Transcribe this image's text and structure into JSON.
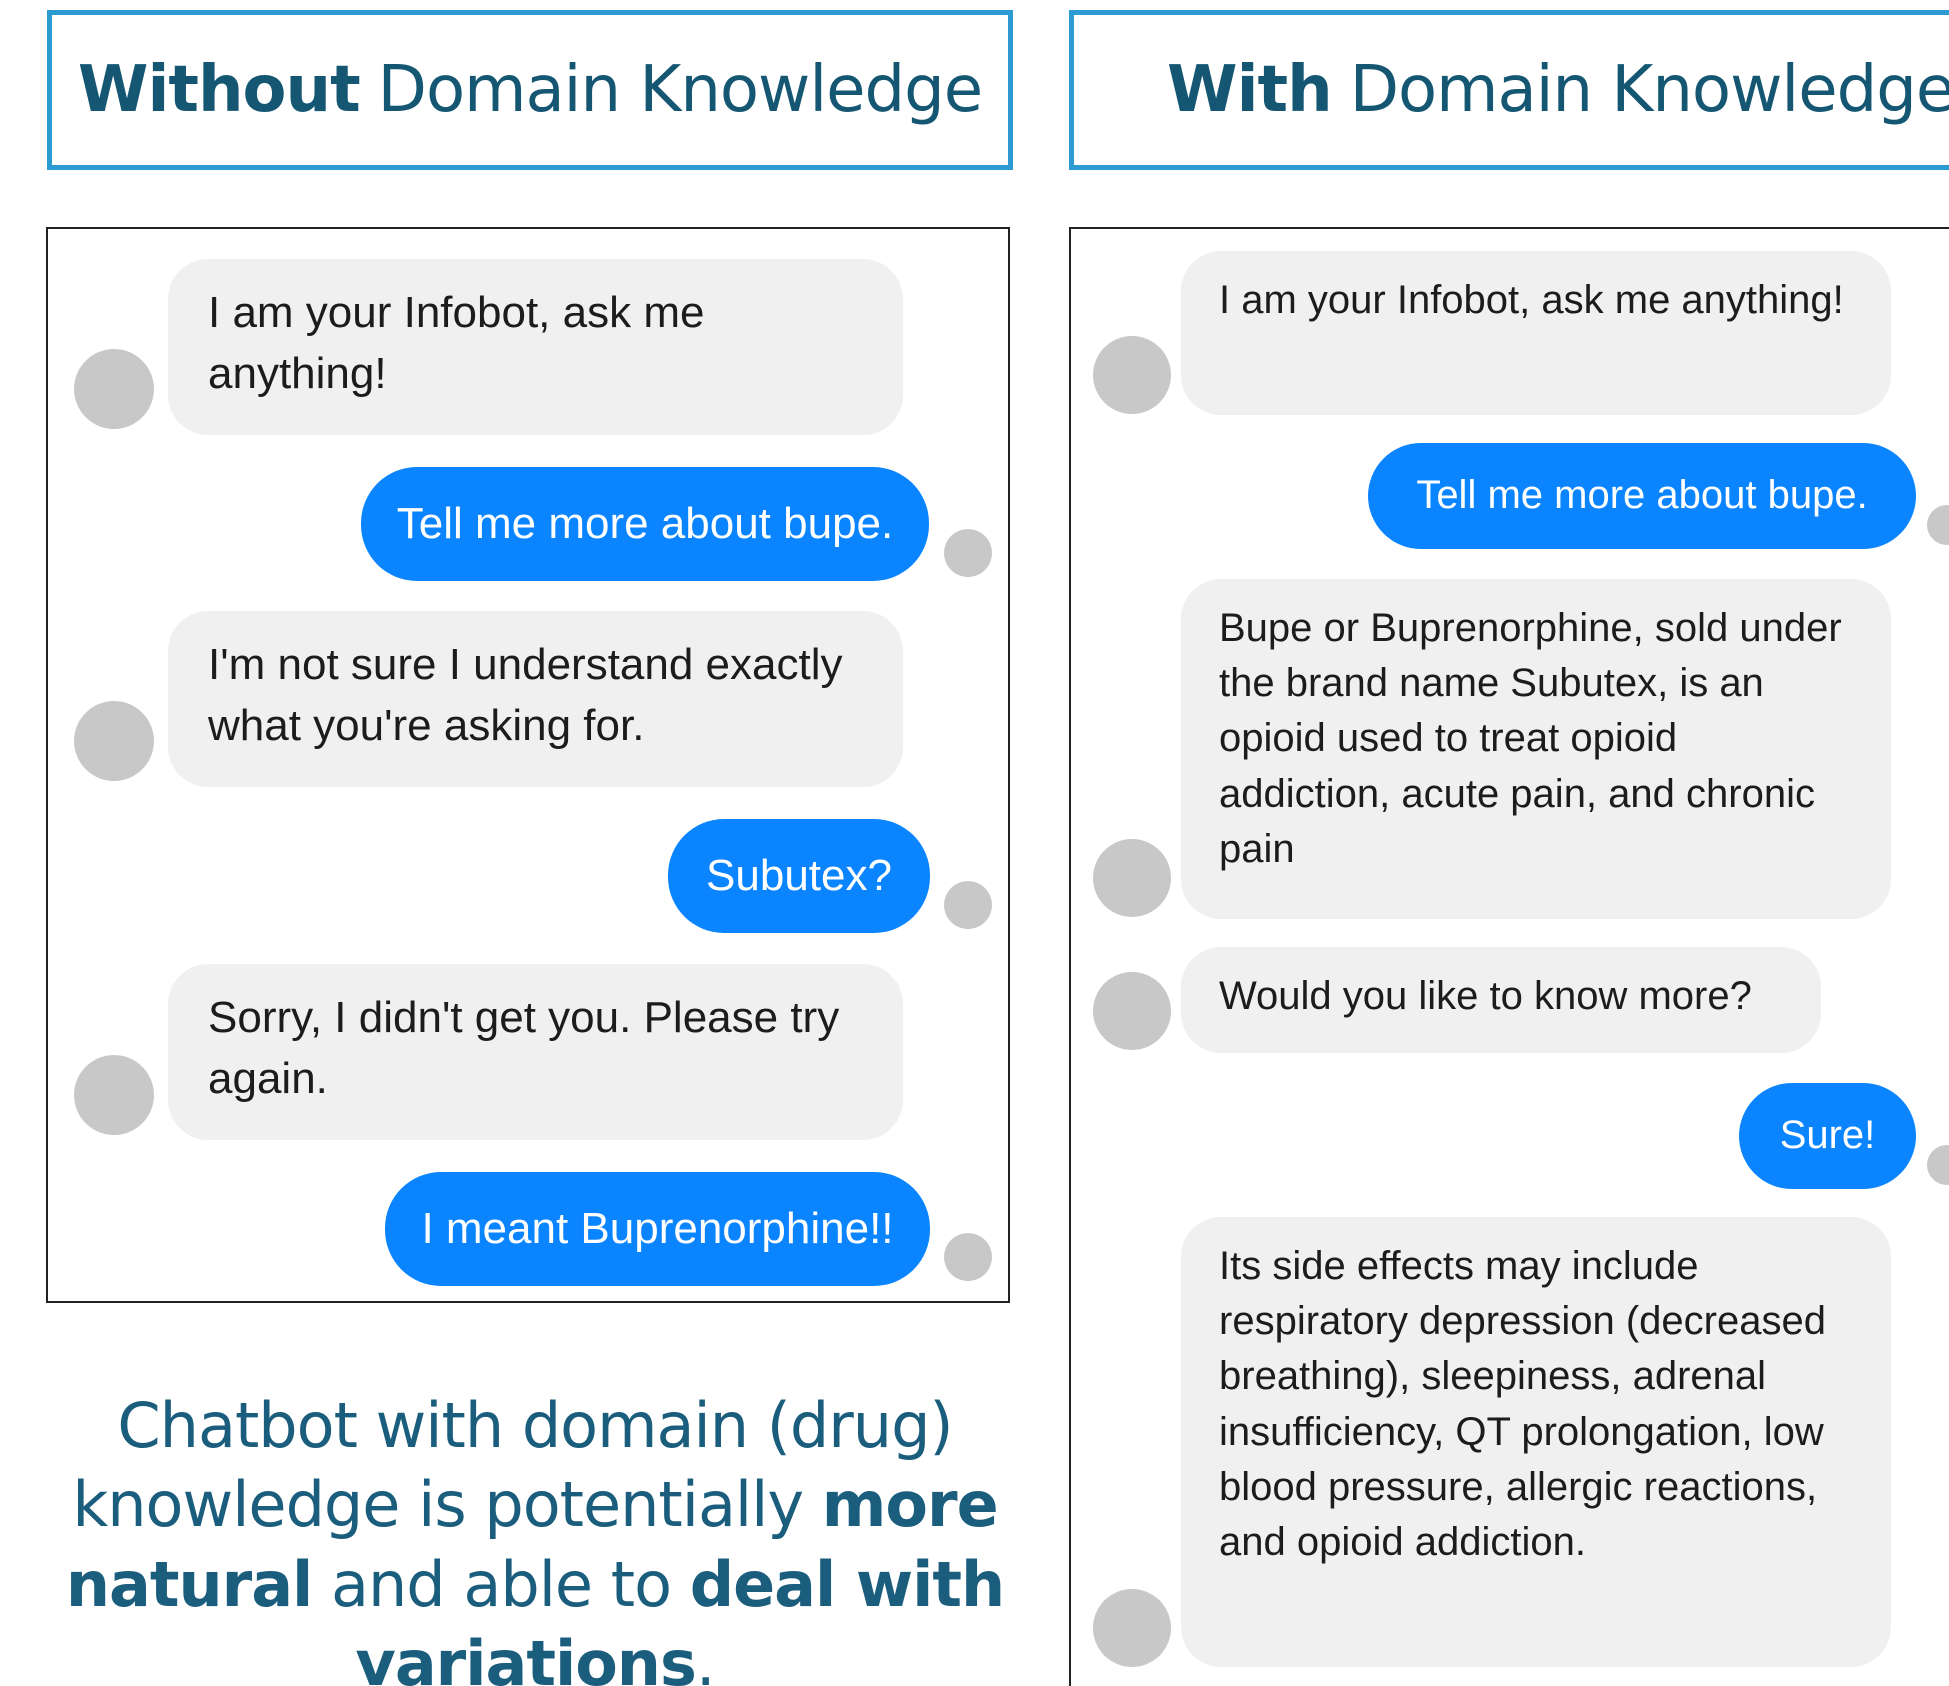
{
  "headers": {
    "left": {
      "strong": "Without",
      "normal": "Domain Knowledge"
    },
    "right": {
      "strong": "With",
      "normal": "Domain Knowledge"
    }
  },
  "left_chat": {
    "messages": [
      {
        "role": "bot",
        "text": "I am your Infobot, ask me anything!"
      },
      {
        "role": "user",
        "text": "Tell me more about bupe."
      },
      {
        "role": "bot",
        "text": "I'm not sure I understand exactly what you're asking for."
      },
      {
        "role": "user",
        "text": "Subutex?"
      },
      {
        "role": "bot",
        "text": "Sorry, I didn't get you. Please try again."
      },
      {
        "role": "user",
        "text": "I meant Buprenorphine!!"
      }
    ]
  },
  "right_chat": {
    "messages": [
      {
        "role": "bot",
        "text": "I am your Infobot, ask me anything!"
      },
      {
        "role": "user",
        "text": "Tell me more about bupe."
      },
      {
        "role": "bot",
        "text": "Bupe or Buprenorphine, sold under the brand name Subutex, is an opioid used to treat opioid addiction, acute pain, and chronic pain"
      },
      {
        "role": "bot",
        "text": "Would you like to know more?"
      },
      {
        "role": "user",
        "text": "Sure!"
      },
      {
        "role": "bot",
        "text": "Its side effects may include respiratory depression (decreased breathing), sleepiness, adrenal insufficiency, QT prolongation, low blood pressure, allergic reactions, and opioid addiction."
      }
    ]
  },
  "caption": {
    "part1": "Chatbot with domain (drug) knowledge is potentially ",
    "bold1": "more natural",
    "part2": " and able to ",
    "bold2": "deal with variations",
    "part3": "."
  },
  "colors": {
    "header_border": "#2c9ad3",
    "header_text": "#155773",
    "user_bubble": "#0a84ff",
    "bot_bubble": "#f0f0f0",
    "avatar": "#c8c8c8",
    "caption_text": "#1b5d7d"
  }
}
